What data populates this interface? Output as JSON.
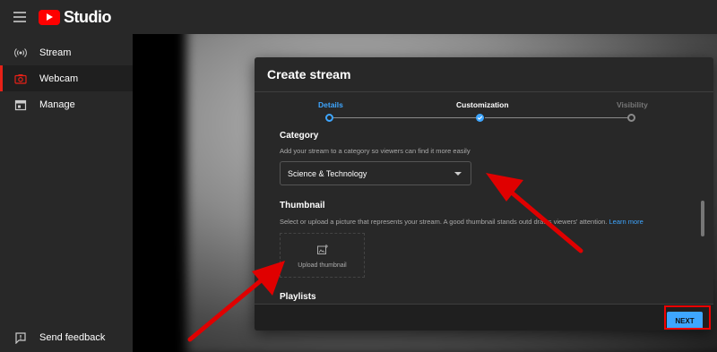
{
  "app": {
    "logo_text": "Studio"
  },
  "sidebar": {
    "items": [
      {
        "label": "Stream",
        "icon": "broadcast-icon"
      },
      {
        "label": "Webcam",
        "icon": "camera-icon"
      },
      {
        "label": "Manage",
        "icon": "calendar-icon"
      }
    ],
    "feedback_label": "Send feedback"
  },
  "dialog": {
    "title": "Create stream",
    "steps": [
      {
        "label": "Details",
        "state": "current"
      },
      {
        "label": "Customization",
        "state": "done"
      },
      {
        "label": "Visibility",
        "state": "pending"
      }
    ],
    "category": {
      "title": "Category",
      "description": "Add your stream to a category so viewers can find it more easily",
      "selected": "Science & Technology"
    },
    "thumbnail": {
      "title": "Thumbnail",
      "description_before": "Select or upload a picture that represents your stream. A good thumbnail stands out",
      "description_after": "d draws viewers' attention.",
      "learn_more": "Learn more",
      "upload_label": "Upload thumbnail"
    },
    "playlists": {
      "title": "Playlists"
    },
    "next_label": "NEXT"
  },
  "colors": {
    "accent": "#3ea6ff",
    "brand": "#ff0000",
    "annotation": "#e00000"
  }
}
